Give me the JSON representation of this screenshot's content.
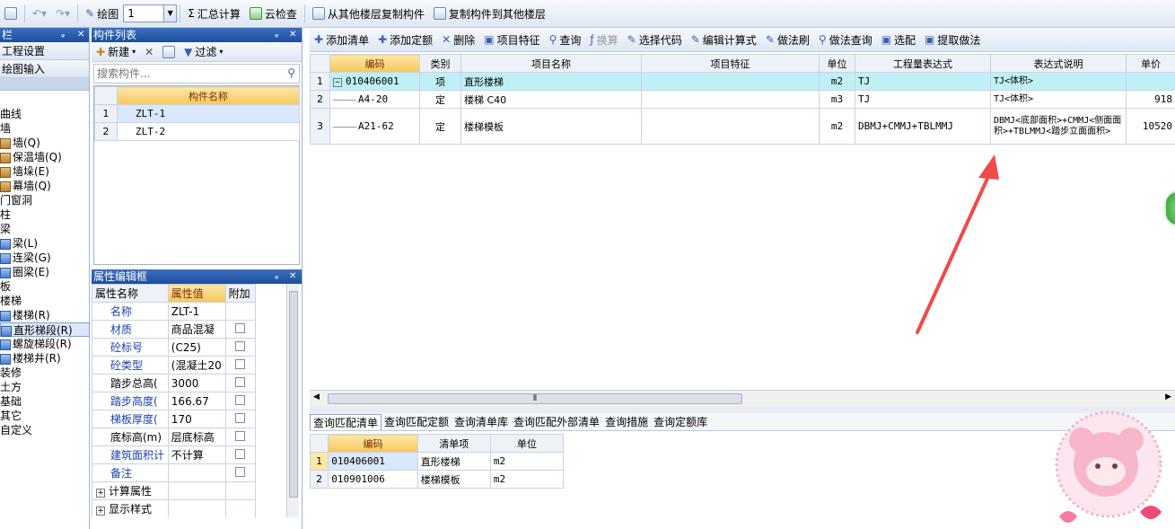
{
  "toolbar": {
    "draw_label": "绘图",
    "floor_value": "1",
    "sum_label": "汇总计算",
    "cloud_label": "云检查",
    "copy_from_label": "从其他楼层复制构件",
    "copy_to_label": "复制构件到其他楼层"
  },
  "left_panel": {
    "title": "栏",
    "menu_items": [
      "工程设置",
      "绘图输入"
    ],
    "tree": [
      {
        "label": "曲线",
        "indent": 0,
        "icon": "none"
      },
      {
        "label": "墙",
        "indent": 0,
        "icon": "none"
      },
      {
        "label": "墙(Q)",
        "indent": 1,
        "icon": "wall-icon"
      },
      {
        "label": "保温墙(Q)",
        "indent": 1,
        "icon": "insulation-wall-icon"
      },
      {
        "label": "墙垛(E)",
        "indent": 1,
        "icon": "wall-pier-icon"
      },
      {
        "label": "幕墙(Q)",
        "indent": 1,
        "icon": "curtain-wall-icon"
      },
      {
        "label": "门窗洞",
        "indent": 0,
        "icon": "none"
      },
      {
        "label": "柱",
        "indent": 0,
        "icon": "none"
      },
      {
        "label": "梁",
        "indent": 0,
        "icon": "none"
      },
      {
        "label": "梁(L)",
        "indent": 1,
        "icon": "beam-icon"
      },
      {
        "label": "连梁(G)",
        "indent": 1,
        "icon": "link-beam-icon"
      },
      {
        "label": "圈梁(E)",
        "indent": 1,
        "icon": "ring-beam-icon"
      },
      {
        "label": "板",
        "indent": 0,
        "icon": "none"
      },
      {
        "label": "楼梯",
        "indent": 0,
        "icon": "none"
      },
      {
        "label": "楼梯(R)",
        "indent": 1,
        "icon": "stair-icon"
      },
      {
        "label": "直形梯段(R)",
        "indent": 1,
        "icon": "straight-stair-icon",
        "selected": true
      },
      {
        "label": "螺旋梯段(R)",
        "indent": 1,
        "icon": "spiral-stair-icon"
      },
      {
        "label": "楼梯井(R)",
        "indent": 1,
        "icon": "stair-well-icon"
      },
      {
        "label": "装修",
        "indent": 0,
        "icon": "none"
      },
      {
        "label": "土方",
        "indent": 0,
        "icon": "none"
      },
      {
        "label": "基础",
        "indent": 0,
        "icon": "none"
      },
      {
        "label": "其它",
        "indent": 0,
        "icon": "none"
      },
      {
        "label": "自定义",
        "indent": 0,
        "icon": "none"
      }
    ]
  },
  "component_list": {
    "title": "构件列表",
    "new_label": "新建",
    "filter_label": "过滤",
    "search_placeholder": "搜索构件...",
    "header": "构件名称",
    "rows": [
      {
        "no": "1",
        "name": "ZLT-1"
      },
      {
        "no": "2",
        "name": "ZLT-2"
      }
    ]
  },
  "property_panel": {
    "title": "属性编辑框",
    "headers": [
      "属性名称",
      "属性值",
      "附加"
    ],
    "rows": [
      {
        "name": "名称",
        "value": "ZLT-1",
        "blue": true,
        "check": false
      },
      {
        "name": "材质",
        "value": "商品混凝",
        "blue": true,
        "check": true
      },
      {
        "name": "砼标号",
        "value": "(C25)",
        "blue": true,
        "check": true
      },
      {
        "name": "砼类型",
        "value": "(混凝土20",
        "blue": true,
        "check": true
      },
      {
        "name": "踏步总高(",
        "value": "3000",
        "blue": false,
        "check": true
      },
      {
        "name": "踏步高度(",
        "value": "166.67",
        "blue": true,
        "check": true
      },
      {
        "name": "梯板厚度(",
        "value": "170",
        "blue": true,
        "check": true
      },
      {
        "name": "底标高(m)",
        "value": "层底标高",
        "blue": false,
        "check": true
      },
      {
        "name": "建筑面积计",
        "value": "不计算",
        "blue": true,
        "check": true
      },
      {
        "name": "备注",
        "value": "",
        "blue": true,
        "check": true
      },
      {
        "name": "计算属性",
        "value": "",
        "blue": false,
        "check": false,
        "expand": true
      },
      {
        "name": "显示样式",
        "value": "",
        "blue": false,
        "check": false,
        "expand": true
      }
    ]
  },
  "right_toolbar": {
    "items": [
      "添加清单",
      "添加定额",
      "删除",
      "项目特征",
      "查询",
      "换算",
      "选择代码",
      "编辑计算式",
      "做法刷",
      "做法查询",
      "选配",
      "提取做法"
    ]
  },
  "main_table": {
    "headers": [
      "编码",
      "类别",
      "项目名称",
      "项目特征",
      "单位",
      "工程量表达式",
      "表达式说明",
      "单价"
    ],
    "rows": [
      {
        "no": "1",
        "code": "010406001",
        "type": "项",
        "name": "直形楼梯",
        "feature": "",
        "unit": "m2",
        "expr": "TJ",
        "desc": "TJ<体积>",
        "price": ""
      },
      {
        "no": "2",
        "code": "A4-20",
        "type": "定",
        "name": "楼梯 C40",
        "feature": "",
        "unit": "m3",
        "expr": "TJ",
        "desc": "TJ<体积>",
        "price": "918"
      },
      {
        "no": "3",
        "code": "A21-62",
        "type": "定",
        "name": "楼梯模板",
        "feature": "",
        "unit": "m2",
        "expr": "DBMJ+CMMJ+TBLMMJ",
        "desc": "DBMJ<底部面积>+CMMJ<侧面面积>+TBLMMJ<踏步立面面积>",
        "price": "10520"
      }
    ]
  },
  "bottom_tabs": [
    "查询匹配清单",
    "查询匹配定额",
    "查询清单库",
    "查询匹配外部清单",
    "查询措施",
    "查询定额库"
  ],
  "bottom_table": {
    "headers": [
      "编码",
      "清单项",
      "单位"
    ],
    "rows": [
      {
        "no": "1",
        "code": "010406001",
        "item": "直形楼梯",
        "unit": "m2"
      },
      {
        "no": "2",
        "code": "010901006",
        "item": "楼梯模板",
        "unit": "m2"
      }
    ]
  },
  "colors": {
    "arrow": "#f04a4a",
    "header_fill": "#f5c75c",
    "selected_row": "#bff0f5"
  }
}
